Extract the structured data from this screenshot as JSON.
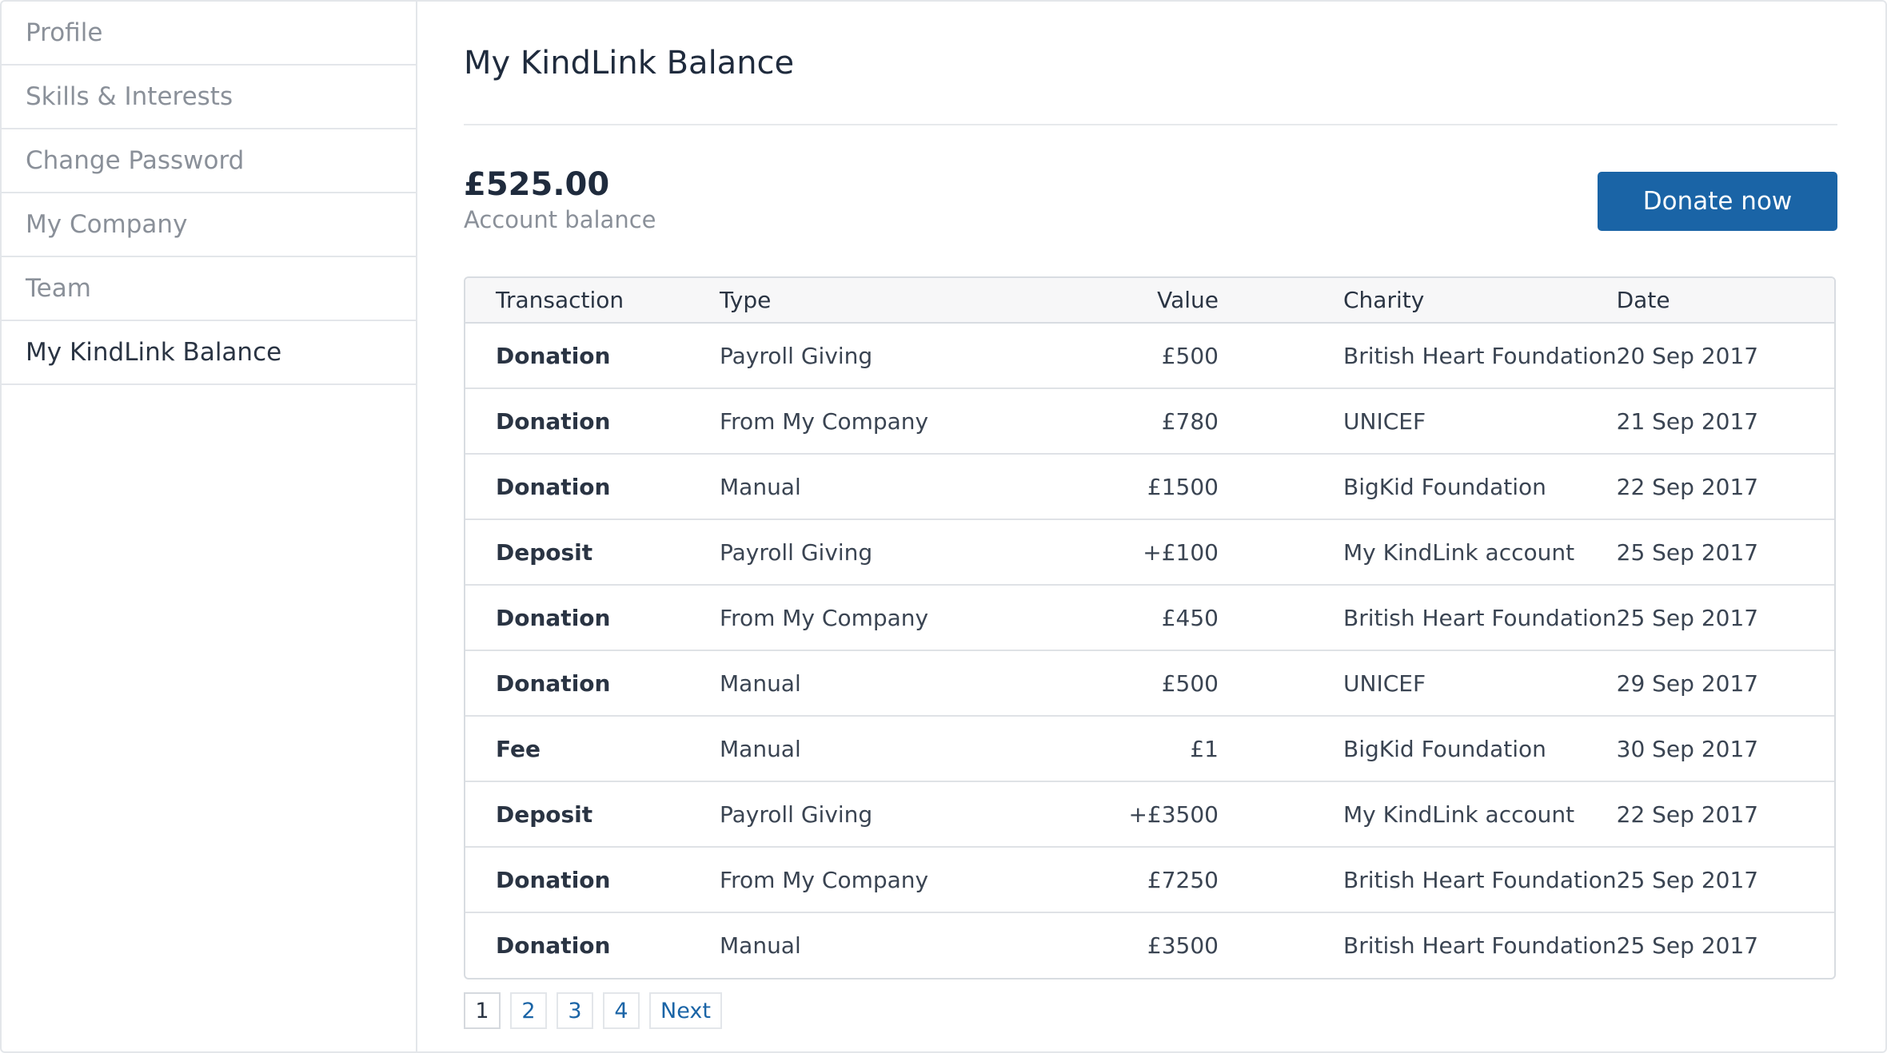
{
  "sidebar": {
    "items": [
      {
        "label": "Profile"
      },
      {
        "label": "Skills & Interests"
      },
      {
        "label": "Change Password"
      },
      {
        "label": "My Company"
      },
      {
        "label": "Team"
      },
      {
        "label": "My KindLink Balance",
        "active": true
      }
    ]
  },
  "main": {
    "title": "My KindLink Balance",
    "balance_amount": "£525.00",
    "balance_label": "Account balance",
    "donate_label": "Donate now"
  },
  "table": {
    "headers": [
      "Transaction",
      "Type",
      "Value",
      "Charity",
      "Date"
    ],
    "rows": [
      {
        "transaction": "Donation",
        "type": "Payroll Giving",
        "value": "£500",
        "charity": "British Heart Foundation",
        "date": "20 Sep 2017"
      },
      {
        "transaction": "Donation",
        "type": "From My Company",
        "value": "£780",
        "charity": "UNICEF",
        "date": "21 Sep 2017"
      },
      {
        "transaction": "Donation",
        "type": "Manual",
        "value": "£1500",
        "charity": "BigKid Foundation",
        "date": "22 Sep 2017"
      },
      {
        "transaction": "Deposit",
        "type": "Payroll Giving",
        "value": "+£100",
        "charity": "My KindLink account",
        "date": "25 Sep 2017"
      },
      {
        "transaction": "Donation",
        "type": "From My Company",
        "value": "£450",
        "charity": "British Heart Foundation",
        "date": "25 Sep 2017"
      },
      {
        "transaction": "Donation",
        "type": "Manual",
        "value": "£500",
        "charity": "UNICEF",
        "date": "29 Sep 2017"
      },
      {
        "transaction": "Fee",
        "type": "Manual",
        "value": "£1",
        "charity": "BigKid Foundation",
        "date": "30 Sep 2017"
      },
      {
        "transaction": "Deposit",
        "type": "Payroll Giving",
        "value": "+£3500",
        "charity": "My KindLink account",
        "date": "22 Sep 2017"
      },
      {
        "transaction": "Donation",
        "type": "From My Company",
        "value": "£7250",
        "charity": "British Heart Foundation",
        "date": "25 Sep 2017"
      },
      {
        "transaction": "Donation",
        "type": "Manual",
        "value": "£3500",
        "charity": "British Heart Foundation",
        "date": "25 Sep 2017"
      }
    ]
  },
  "pagination": {
    "pages": [
      "1",
      "2",
      "3",
      "4"
    ],
    "current": "1",
    "next_label": "Next"
  },
  "colors": {
    "accent": "#1a64a6",
    "text": "#2a3443",
    "muted": "#8a9099",
    "border": "#e3e6ea"
  }
}
